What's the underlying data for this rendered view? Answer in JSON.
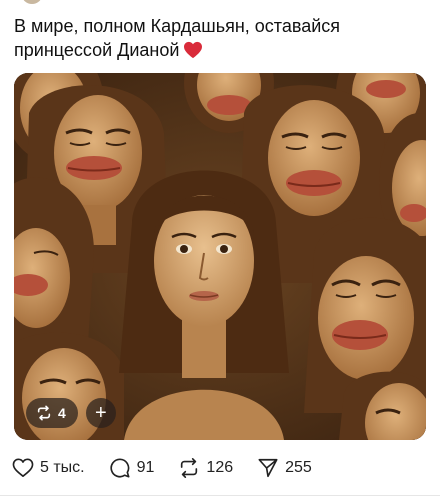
{
  "post": {
    "text": "В мире, полном Кардашьян, оставайся принцессой Дианой",
    "emoji": "red-heart"
  },
  "media": {
    "description_colors": {
      "background": "#4a2e16",
      "skin": "#c9965f",
      "hair": "#5a3519",
      "lips": "#b5503a"
    },
    "repost_count": "4",
    "add_symbol": "+"
  },
  "actions": {
    "likes": "5 тыс.",
    "comments": "91",
    "reposts": "126",
    "shares": "255"
  },
  "icons": {
    "like": "heart-outline-icon",
    "comment": "speech-bubble-icon",
    "repost": "repost-arrows-icon",
    "share": "paper-plane-icon"
  }
}
